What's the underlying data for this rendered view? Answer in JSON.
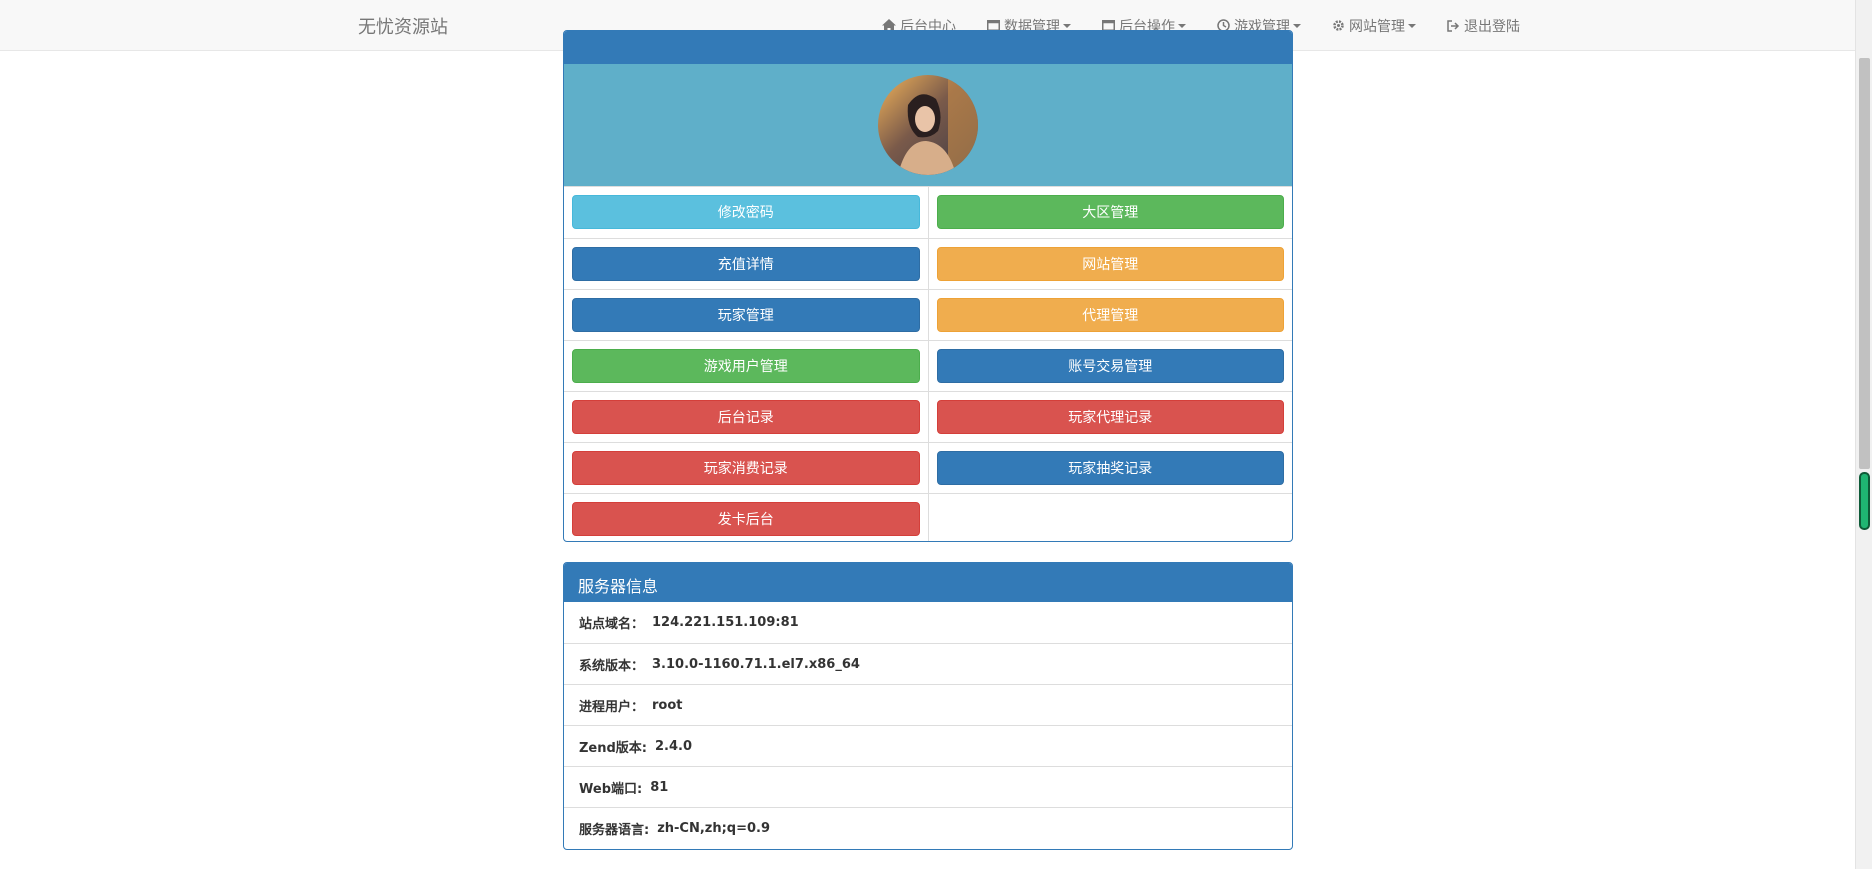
{
  "navbar": {
    "brand": "无忧资源站",
    "items": [
      {
        "label": "后台中心",
        "icon": "home-icon",
        "dropdown": false
      },
      {
        "label": "数据管理",
        "icon": "window-icon",
        "dropdown": true
      },
      {
        "label": "后台操作",
        "icon": "window-icon",
        "dropdown": true
      },
      {
        "label": "游戏管理",
        "icon": "clock-icon",
        "dropdown": true
      },
      {
        "label": "网站管理",
        "icon": "gear-icon",
        "dropdown": true
      },
      {
        "label": "退出登陆",
        "icon": "logout-icon",
        "dropdown": false
      }
    ]
  },
  "admin_panel": {
    "buttons": [
      {
        "label": "修改密码",
        "style": "info"
      },
      {
        "label": "大区管理",
        "style": "success"
      },
      {
        "label": "充值详情",
        "style": "primary"
      },
      {
        "label": "网站管理",
        "style": "warning"
      },
      {
        "label": "玩家管理",
        "style": "primary"
      },
      {
        "label": "代理管理",
        "style": "warning"
      },
      {
        "label": "游戏用户管理",
        "style": "success"
      },
      {
        "label": "账号交易管理",
        "style": "primary"
      },
      {
        "label": "后台记录",
        "style": "danger"
      },
      {
        "label": "玩家代理记录",
        "style": "danger"
      },
      {
        "label": "玩家消费记录",
        "style": "danger"
      },
      {
        "label": "玩家抽奖记录",
        "style": "primary"
      },
      {
        "label": "发卡后台",
        "style": "danger"
      }
    ]
  },
  "server_panel": {
    "title": "服务器信息",
    "rows": [
      {
        "label": "站点域名：",
        "value": "124.221.151.109:81"
      },
      {
        "label": "系统版本：",
        "value": "3.10.0-1160.71.1.el7.x86_64"
      },
      {
        "label": "进程用户：",
        "value": "root"
      },
      {
        "label": "Zend版本:",
        "value": "2.4.0"
      },
      {
        "label": "Web端口:",
        "value": "81"
      },
      {
        "label": "服务器语言:",
        "value": "zh-CN,zh;q=0.9"
      }
    ]
  },
  "colors": {
    "primary": "#337ab7",
    "info": "#5bc0de",
    "success": "#5cb85c",
    "warning": "#f0ad4e",
    "danger": "#d9534f",
    "avatar_bg": "#5fafc9"
  }
}
